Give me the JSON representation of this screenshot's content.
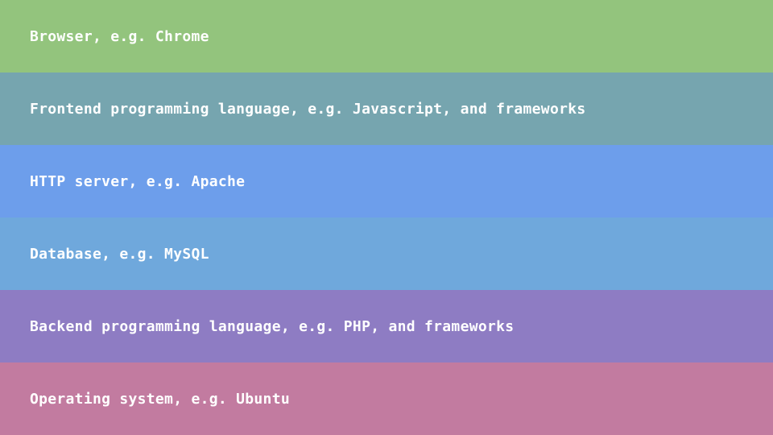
{
  "layers": [
    {
      "label": "Browser, e.g. Chrome",
      "color": "#93c47d"
    },
    {
      "label": "Frontend programming language, e.g. Javascript, and frameworks",
      "color": "#76a5af"
    },
    {
      "label": "HTTP server, e.g. Apache",
      "color": "#6d9eeb"
    },
    {
      "label": "Database, e.g. MySQL",
      "color": "#6fa8dc"
    },
    {
      "label": "Backend programming language, e.g. PHP, and frameworks",
      "color": "#8e7cc3"
    },
    {
      "label": "Operating system, e.g. Ubuntu",
      "color": "#c27ba0"
    }
  ]
}
